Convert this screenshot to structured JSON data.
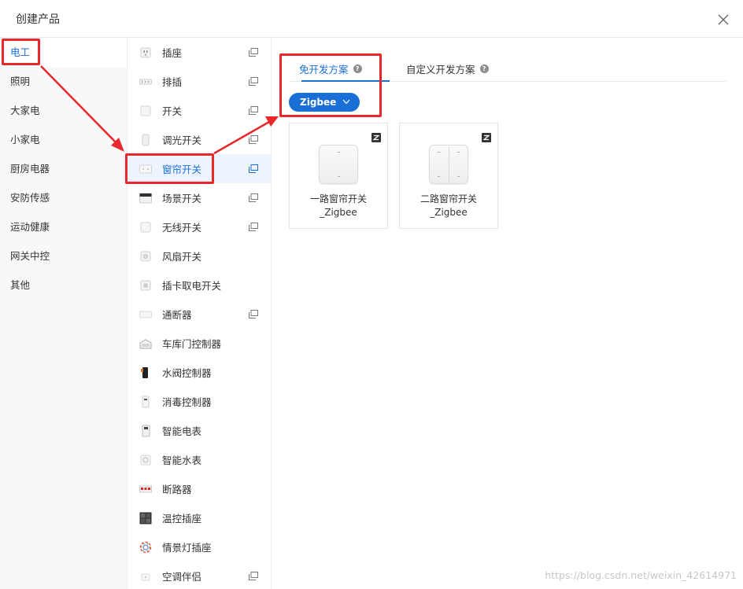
{
  "dialog": {
    "title": "创建产品",
    "close_icon": "close-icon"
  },
  "categories": [
    {
      "label": "电工",
      "active": true
    },
    {
      "label": "照明"
    },
    {
      "label": "大家电"
    },
    {
      "label": "小家电"
    },
    {
      "label": "厨房电器"
    },
    {
      "label": "安防传感"
    },
    {
      "label": "运动健康"
    },
    {
      "label": "网关中控"
    },
    {
      "label": "其他"
    }
  ],
  "subcategories": [
    {
      "label": "插座",
      "icon": "socket-icon",
      "copy": true
    },
    {
      "label": "排插",
      "icon": "power-strip-icon",
      "copy": true
    },
    {
      "label": "开关",
      "icon": "switch-icon",
      "copy": true
    },
    {
      "label": "调光开关",
      "icon": "dimmer-icon",
      "copy": true
    },
    {
      "label": "窗帘开关",
      "icon": "curtain-switch-icon",
      "copy": true,
      "active": true
    },
    {
      "label": "场景开关",
      "icon": "scene-switch-icon",
      "copy": true
    },
    {
      "label": "无线开关",
      "icon": "wireless-switch-icon",
      "copy": true
    },
    {
      "label": "风扇开关",
      "icon": "fan-switch-icon"
    },
    {
      "label": "插卡取电开关",
      "icon": "card-switch-icon"
    },
    {
      "label": "通断器",
      "icon": "breaker-module-icon",
      "copy": true
    },
    {
      "label": "车库门控制器",
      "icon": "garage-door-icon"
    },
    {
      "label": "水阀控制器",
      "icon": "water-valve-icon"
    },
    {
      "label": "消毒控制器",
      "icon": "disinfection-icon"
    },
    {
      "label": "智能电表",
      "icon": "electric-meter-icon"
    },
    {
      "label": "智能水表",
      "icon": "water-meter-icon"
    },
    {
      "label": "断路器",
      "icon": "circuit-breaker-icon"
    },
    {
      "label": "温控插座",
      "icon": "thermostat-socket-icon"
    },
    {
      "label": "情景灯插座",
      "icon": "scene-light-socket-icon"
    },
    {
      "label": "空调伴侣",
      "icon": "ac-companion-icon",
      "copy": true
    }
  ],
  "tabs": [
    {
      "label": "免开发方案",
      "active": true
    },
    {
      "label": "自定义开发方案"
    }
  ],
  "protocol": {
    "selected": "Zigbee"
  },
  "products": [
    {
      "line1": "一路窗帘开关",
      "line2": "_Zigbee",
      "gangs": 1
    },
    {
      "line1": "二路窗帘开关",
      "line2": "_Zigbee",
      "gangs": 2
    }
  ],
  "watermark": "https://blog.csdn.net/weixin_42614971",
  "colors": {
    "accent": "#1a6fd6",
    "annotation": "#e8282b"
  }
}
